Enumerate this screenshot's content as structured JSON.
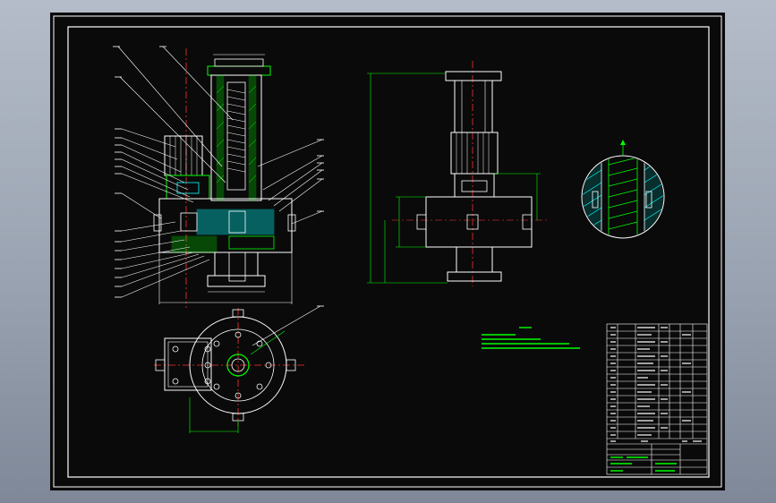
{
  "viewport": {
    "background": "#0a0a0a"
  },
  "colors": {
    "outline": "#ffffff",
    "part": "#00ff00",
    "section": "#00ffff",
    "centerline": "#ff3030",
    "leader": "#ffffff",
    "note": "#00ff00",
    "table": "#ffffff"
  },
  "views": [
    {
      "id": "front-section-view"
    },
    {
      "id": "side-view"
    },
    {
      "id": "top-view"
    },
    {
      "id": "detail-view"
    }
  ]
}
